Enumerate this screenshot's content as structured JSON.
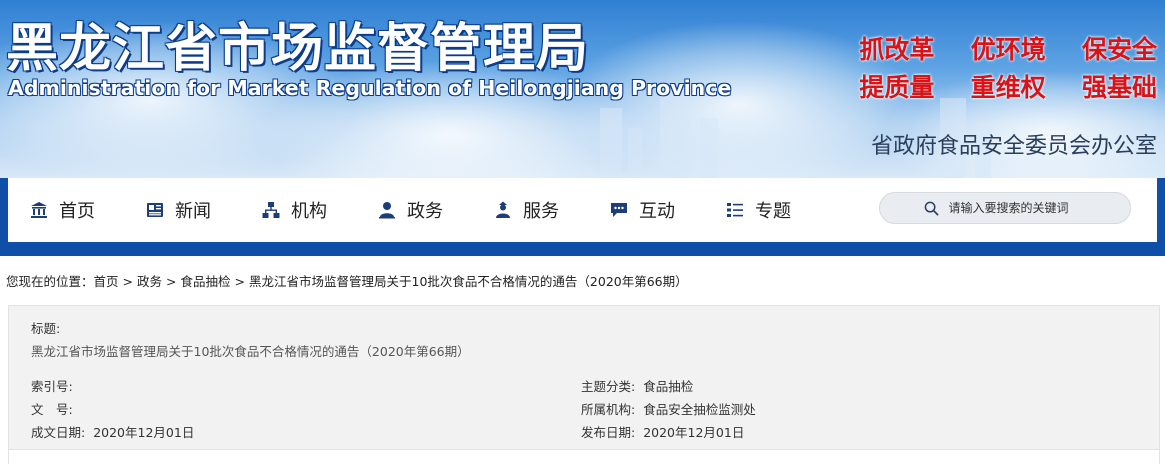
{
  "header": {
    "title_cn": "黑龙江省市场监督管理局",
    "title_en": "Administration for Market Regulation of Heilongjiang Province",
    "slogans": [
      "抓改革",
      "优环境",
      "保安全",
      "提质量",
      "重维权",
      "强基础"
    ],
    "office": "省政府食品安全委员会办公室"
  },
  "nav": {
    "items": [
      {
        "label": "首页",
        "icon": "building-icon"
      },
      {
        "label": "新闻",
        "icon": "newspaper-icon"
      },
      {
        "label": "机构",
        "icon": "org-chart-icon"
      },
      {
        "label": "政务",
        "icon": "user-icon"
      },
      {
        "label": "服务",
        "icon": "service-user-icon"
      },
      {
        "label": "互动",
        "icon": "chat-icon"
      },
      {
        "label": "专题",
        "icon": "list-icon"
      }
    ],
    "search_placeholder": "请输入要搜索的关键词"
  },
  "breadcrumb": {
    "prefix": "您现在的位置：",
    "items": [
      "首页",
      "政务",
      "食品抽检",
      "黑龙江省市场监督管理局关于10批次食品不合格情况的通告（2020年第66期）"
    ],
    "separator": ">"
  },
  "info": {
    "title_label": "标题:",
    "title_value": "黑龙江省市场监督管理局关于10批次食品不合格情况的通告（2020年第66期）",
    "index_label": "索引号:",
    "index_value": "",
    "doc_no_label": "文　号:",
    "doc_no_value": "",
    "date_written_label": "成文日期:",
    "date_written_value": "2020年12月01日",
    "topic_label": "主题分类:",
    "topic_value": "食品抽检",
    "org_label": "所属机构:",
    "org_value": "食品安全抽检监测处",
    "publish_label": "发布日期:",
    "publish_value": "2020年12月01日"
  },
  "colors": {
    "nav_bar": "#0f4fa8",
    "slogan": "#d7141a",
    "title_outline": "#0c3d8a",
    "icon": "#1c3d78"
  }
}
